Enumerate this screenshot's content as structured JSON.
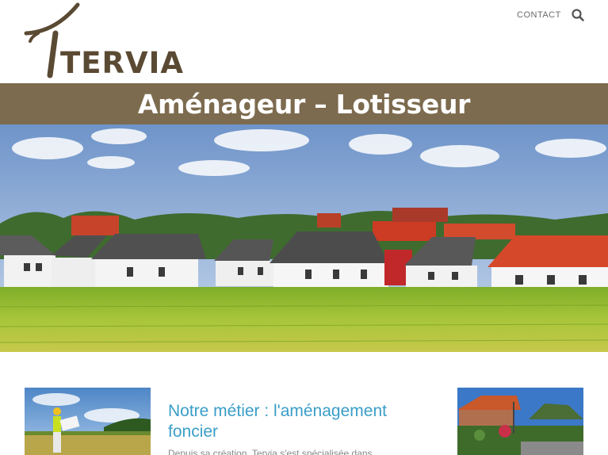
{
  "header": {
    "logo_text": "TERVIA",
    "nav_contact": "CONTACT",
    "search_icon": "search-icon"
  },
  "banner": {
    "title": "Aménageur – Lotisseur"
  },
  "main": {
    "section_title": "Notre métier : l'aménagement foncier",
    "section_text": "Depuis sa création, Tervia s'est spécialisée dans"
  },
  "colors": {
    "brand_brown": "#7d6b4f",
    "logo_brown": "#5b4a33",
    "link_blue": "#3a9ec8"
  }
}
